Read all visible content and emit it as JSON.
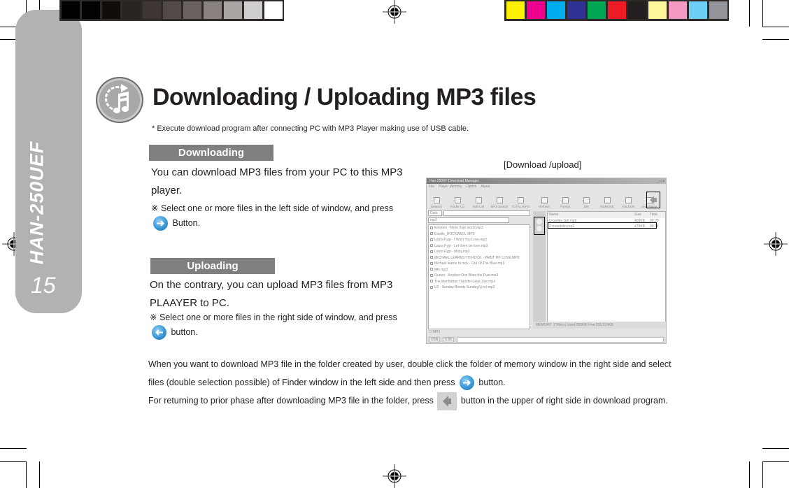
{
  "color_bars": {
    "grayscale": [
      "#000000",
      "#020202",
      "#110d0a",
      "#282422",
      "#3e3634",
      "#524a48",
      "#6a6260",
      "#8a8280",
      "#aaa6a4",
      "#d0cecd",
      "#ffffff"
    ],
    "process": [
      "#fff200",
      "#ec008c",
      "#00aeef",
      "#2e3192",
      "#00a651",
      "#ed1c24",
      "#231f20",
      "#fff799",
      "#f49ac1",
      "#6dcff6",
      "#939598"
    ]
  },
  "side_tab": {
    "model": "HAN-250UEF",
    "page_number": "15"
  },
  "header": {
    "icon": "music-note-transfer-icon",
    "title": "Downloading / Uploading MP3 files",
    "subtitle": "* Execute download program after connecting PC with MP3 Player making use of USB cable."
  },
  "downloading": {
    "heading": "Downloading",
    "text": "You can download MP3 files from your PC to this MP3 player.",
    "note_mark": "※",
    "note_before": "Select one or more files in the left side of window, and press",
    "note_after": "Button.",
    "note_icon": "right-arrow-button-icon"
  },
  "uploading": {
    "heading": "Uploading",
    "text": "On the contrary, you can upload MP3 files from MP3 PLAAYER to PC.",
    "note_mark": "※",
    "note_before": "Select one or more files in the right side of window, and press",
    "note_after": "button.",
    "note_icon": "left-arrow-button-icon"
  },
  "figure": {
    "caption": "[Download /upload]",
    "window": {
      "title": "Han-250EF Download Manager",
      "menu": [
        "File",
        "Player Memory",
        "Option",
        "About"
      ],
      "left_toolbar": [
        "Network",
        "Folder Up",
        "Edit List",
        "MP3 Search",
        "TOTAL INFO"
      ],
      "right_toolbar": [
        "Refresh",
        "Format",
        "Del",
        "REMOVE",
        "FOLDER",
        "User Name"
      ],
      "drive_label": "Data",
      "folder_combo": "mp3",
      "left_files": [
        "Eminem - More than world.mp3",
        "Estelle_ROCKWELL.MP3",
        "Laura Fygi - I Wish You Love.mp3",
        "Laura Fygi - Let there be love.mp3",
        "Laura Fygi - Misty.mp3",
        "MICHAEL LEARNS TO ROCK - PAINT MY LOVE.MP3",
        "Michael learns to rock - Out Of The Blue.mp3",
        "MR.mp3",
        "Queen - Another One Bites the Dust.mp3",
        "The Manhattan Transfer-Java Jive.mp3",
        "U2 - Sunday Bloody Sunday(Live).mp3"
      ],
      "right_columns": [
        "Name",
        "Size",
        "Time"
      ],
      "right_files": [
        {
          "name": "U-barbie Girl.mp3",
          "size": "409KB",
          "time": "00:29"
        },
        {
          "name": "Z-mandolin.mp3",
          "size": "479KB",
          "time": "00:38"
        }
      ],
      "status": "2 File(s)   Used 955KB   Free 255,519KB",
      "status_label": "MEMORY",
      "mp3_checkbox": "MP3",
      "bottom_cells": [
        "USB",
        "5.96"
      ]
    }
  },
  "body": {
    "p1_before": "When you want to download MP3 file in the folder created by user, double click the folder of memory window in the right side and select files (double selection possible) of Finder window in the left side and then press",
    "p1_after": "button.",
    "p2_before": "For returning to prior phase after downloading MP3 file in the folder, press",
    "p2_after": "button in the upper of right side in download program."
  }
}
